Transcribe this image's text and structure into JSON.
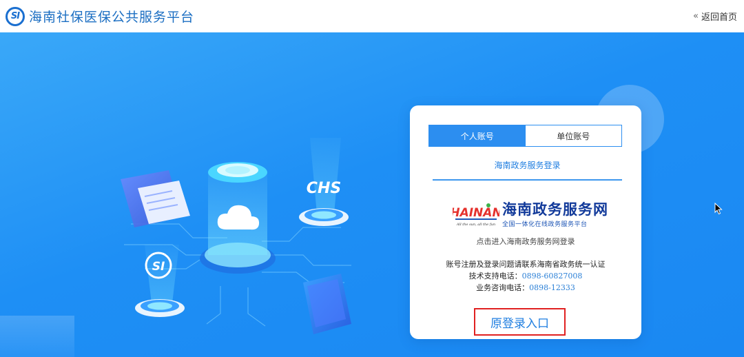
{
  "header": {
    "logo_text": "SI",
    "title": "海南社保医保公共服务平台",
    "back_chevron": "«",
    "back_label": "返回首页"
  },
  "illustration": {
    "chs_label": "CHS",
    "si_label": "SI"
  },
  "login": {
    "tabs": [
      {
        "label": "个人账号",
        "active": true
      },
      {
        "label": "单位账号",
        "active": false
      }
    ],
    "subtab_label": "海南政务服务登录",
    "portal": {
      "logo_word": "HAINAN",
      "logo_tagline": "All the sun, all the fun",
      "name": "海南政务服务网",
      "subtitle": "全国一体化在线政务服务平台",
      "hint": "点击进入海南政务服务网登录"
    },
    "info": {
      "line1": "账号注册及登录问题请联系海南省政务统一认证",
      "tech_label": "技术支持电话：",
      "tech_phone": "0898-60827008",
      "biz_label": "业务咨询电话：",
      "biz_phone": "0898-12333"
    },
    "legacy_button": "原登录入口"
  },
  "colors": {
    "brand_blue": "#1b6ec2",
    "hero_blue": "#1e8ff5",
    "tab_active": "#2c8ef0",
    "highlight_red": "#e02020"
  }
}
